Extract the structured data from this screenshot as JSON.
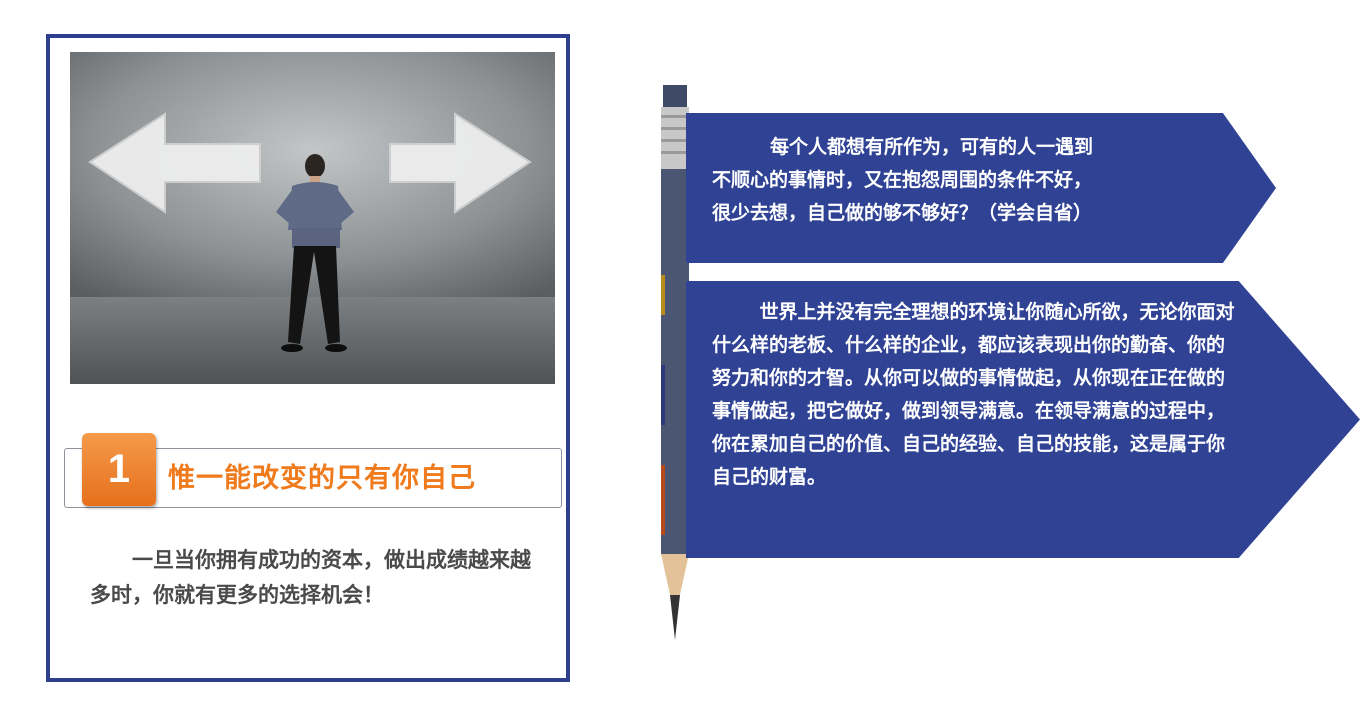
{
  "card": {
    "number": "1",
    "heading": "惟一能改变的只有你自己",
    "body": "一旦当你拥有成功的资本，做出成绩越来越多时，你就有更多的选择机会！"
  },
  "banners": [
    {
      "lines": [
        "每个人都想有所作为，可有的人一遇到",
        "不顺心的事情时，又在抱怨周围的条件不好，",
        "很少去想，自己做的够不够好？（学会自省）"
      ]
    },
    {
      "text": "世界上并没有完全理想的环境让你随心所欲，无论你面对什么样的老板、什么样的企业，都应该表现出你的勤奋、你的努力和你的才智。从你可以做的事情做起，从你现在正在做的事情做起，把它做好，做到领导满意。在领导满意的过程中，你在累加自己的价值、自己的经验、自己的技能，这是属于你自己的财富。"
    }
  ],
  "colors": {
    "frame": "#2e3f8f",
    "banner": "#2f4294",
    "accent": "#ef7b1d",
    "body_text": "#4a4a4a"
  },
  "icons": [
    "left-arrow-icon",
    "right-arrow-icon",
    "pencil-icon"
  ]
}
